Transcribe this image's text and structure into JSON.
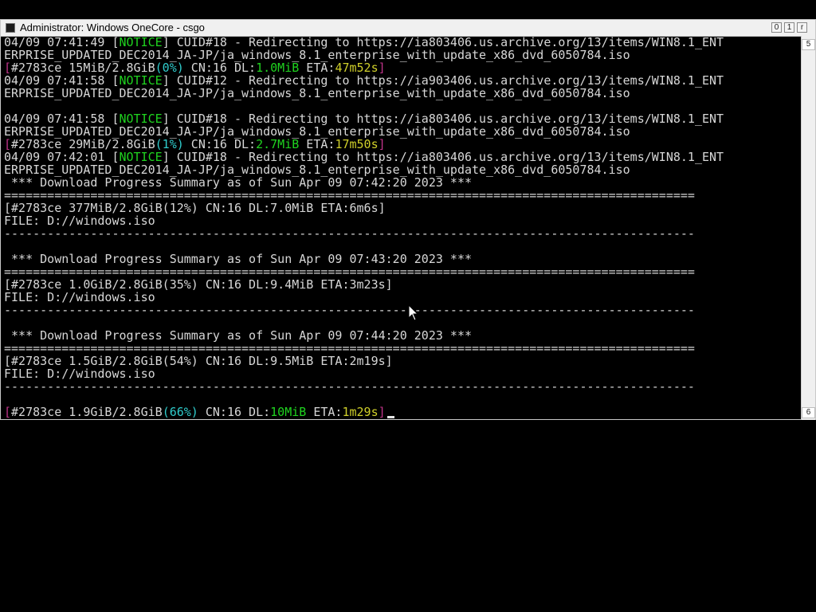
{
  "window": {
    "title": "Administrator:  Windows OneCore - csgo",
    "min_label": "0",
    "max_label": "1",
    "close_label": "r",
    "scroll_up": "5",
    "scroll_down": "6"
  },
  "console": {
    "lines": [
      [
        {
          "t": "04/09 07:41:49 [",
          "c": ""
        },
        {
          "t": "NOTICE",
          "c": "g"
        },
        {
          "t": "] CUID#18 - Redirecting to https://ia803406.us.archive.org/13/items/WIN8.1_ENT",
          "c": ""
        }
      ],
      [
        {
          "t": "ERPRISE_UPDATED_DEC2014_JA-JP/ja_windows_8.1_enterprise_with_update_x86_dvd_6050784.iso",
          "c": ""
        }
      ],
      [
        {
          "t": "[",
          "c": "m"
        },
        {
          "t": "#2783ce 15MiB/2.8GiB",
          "c": ""
        },
        {
          "t": "(0%)",
          "c": "c"
        },
        {
          "t": " CN:16 DL:",
          "c": ""
        },
        {
          "t": "1.0MiB",
          "c": "g"
        },
        {
          "t": " ETA:",
          "c": ""
        },
        {
          "t": "47m52s",
          "c": "y"
        },
        {
          "t": "]",
          "c": "m"
        }
      ],
      [
        {
          "t": "04/09 07:41:58 [",
          "c": ""
        },
        {
          "t": "NOTICE",
          "c": "g"
        },
        {
          "t": "] CUID#12 - Redirecting to https://ia903406.us.archive.org/13/items/WIN8.1_ENT",
          "c": ""
        }
      ],
      [
        {
          "t": "ERPRISE_UPDATED_DEC2014_JA-JP/ja_windows_8.1_enterprise_with_update_x86_dvd_6050784.iso",
          "c": ""
        }
      ],
      [
        {
          "t": "",
          "c": ""
        }
      ],
      [
        {
          "t": "04/09 07:41:58 [",
          "c": ""
        },
        {
          "t": "NOTICE",
          "c": "g"
        },
        {
          "t": "] CUID#18 - Redirecting to https://ia803406.us.archive.org/13/items/WIN8.1_ENT",
          "c": ""
        }
      ],
      [
        {
          "t": "ERPRISE_UPDATED_DEC2014_JA-JP/ja_windows_8.1_enterprise_with_update_x86_dvd_6050784.iso",
          "c": ""
        }
      ],
      [
        {
          "t": "[",
          "c": "m"
        },
        {
          "t": "#2783ce 29MiB/2.8GiB",
          "c": ""
        },
        {
          "t": "(1%)",
          "c": "c"
        },
        {
          "t": " CN:16 DL:",
          "c": ""
        },
        {
          "t": "2.7MiB",
          "c": "g"
        },
        {
          "t": " ETA:",
          "c": ""
        },
        {
          "t": "17m50s",
          "c": "y"
        },
        {
          "t": "]",
          "c": "m"
        }
      ],
      [
        {
          "t": "04/09 07:42:01 [",
          "c": ""
        },
        {
          "t": "NOTICE",
          "c": "g"
        },
        {
          "t": "] CUID#18 - Redirecting to https://ia803406.us.archive.org/13/items/WIN8.1_ENT",
          "c": ""
        }
      ],
      [
        {
          "t": "ERPRISE_UPDATED_DEC2014_JA-JP/ja_windows_8.1_enterprise_with_update_x86_dvd_6050784.iso",
          "c": ""
        }
      ],
      [
        {
          "t": " *** Download Progress Summary as of Sun Apr 09 07:42:20 2023 ***",
          "c": ""
        }
      ],
      [
        {
          "t": "================================================================================================",
          "c": ""
        }
      ],
      [
        {
          "t": "[#2783ce 377MiB/2.8GiB(12%) CN:16 DL:7.0MiB ETA:6m6s]",
          "c": ""
        }
      ],
      [
        {
          "t": "FILE: D://windows.iso",
          "c": ""
        }
      ],
      [
        {
          "t": "------------------------------------------------------------------------------------------------",
          "c": ""
        }
      ],
      [
        {
          "t": "",
          "c": ""
        }
      ],
      [
        {
          "t": " *** Download Progress Summary as of Sun Apr 09 07:43:20 2023 ***",
          "c": ""
        }
      ],
      [
        {
          "t": "================================================================================================",
          "c": ""
        }
      ],
      [
        {
          "t": "[#2783ce 1.0GiB/2.8GiB(35%) CN:16 DL:9.4MiB ETA:3m23s]",
          "c": ""
        }
      ],
      [
        {
          "t": "FILE: D://windows.iso",
          "c": ""
        }
      ],
      [
        {
          "t": "------------------------------------------------------------------------------------------------",
          "c": ""
        }
      ],
      [
        {
          "t": "",
          "c": ""
        }
      ],
      [
        {
          "t": " *** Download Progress Summary as of Sun Apr 09 07:44:20 2023 ***",
          "c": ""
        }
      ],
      [
        {
          "t": "================================================================================================",
          "c": ""
        }
      ],
      [
        {
          "t": "[#2783ce 1.5GiB/2.8GiB(54%) CN:16 DL:9.5MiB ETA:2m19s]",
          "c": ""
        }
      ],
      [
        {
          "t": "FILE: D://windows.iso",
          "c": ""
        }
      ],
      [
        {
          "t": "------------------------------------------------------------------------------------------------",
          "c": ""
        }
      ],
      [
        {
          "t": "",
          "c": ""
        }
      ],
      [
        {
          "t": "[",
          "c": "m"
        },
        {
          "t": "#2783ce 1.9GiB/2.8GiB",
          "c": ""
        },
        {
          "t": "(66%)",
          "c": "c"
        },
        {
          "t": " CN:16 DL:",
          "c": ""
        },
        {
          "t": "10MiB",
          "c": "g"
        },
        {
          "t": " ETA:",
          "c": ""
        },
        {
          "t": "1m29s",
          "c": "y"
        },
        {
          "t": "]",
          "c": "m"
        }
      ]
    ]
  },
  "colors": {
    "text": "#d7d7d7",
    "notice": "#1fd31f",
    "percent": "#2fcccc",
    "eta": "#cfcf2a",
    "bracket": "#c1338a",
    "background": "#000000"
  }
}
